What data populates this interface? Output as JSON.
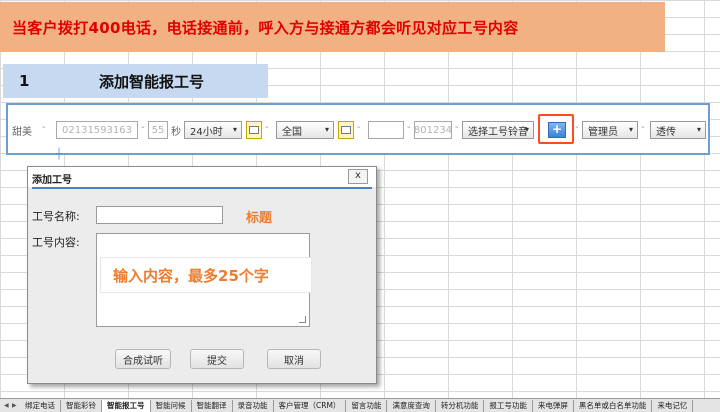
{
  "banner": {
    "text": "当客户拨打400电话，电话接通前，呼入方与接通方都会听见对应工号内容"
  },
  "section": {
    "number": "1",
    "title": "添加智能报工号"
  },
  "toolbar": {
    "label_tianmei": "甜美",
    "phone_value": "02131593163",
    "seconds_value": "55",
    "seconds_unit": "秒",
    "hours_select": "24小时",
    "region_select": "全国",
    "field_empty": "",
    "ext_value": "801234",
    "ringtone_select": "选择工号铃音",
    "add_icon": "+",
    "role_select": "管理员",
    "mode_select": "透传",
    "arrow": "▾"
  },
  "dialog": {
    "title": "添加工号",
    "close": "x",
    "name_label": "工号名称:",
    "content_label": "工号内容:",
    "name_value": "",
    "name_note": "标题",
    "content_note": "输入内容，最多25个字",
    "synth_button": "合成试听",
    "submit_button": "提交",
    "cancel_button": "取消"
  },
  "tabs": {
    "items": [
      "绑定电话",
      "智能彩铃",
      "智能报工号",
      "智能问候",
      "智能翻译",
      "录音功能",
      "客户管理（CRM）",
      "留言功能",
      "满意度查询",
      "转分机功能",
      "报工号功能",
      "来电弹屏",
      "黑名单或白名单功能",
      "来电记忆"
    ],
    "active_index": 2
  },
  "colors": {
    "banner_bg": "#f2b183",
    "banner_text": "#e00000",
    "section_bg": "#c6d9f1",
    "note": "#ed7d31",
    "highlight": "#ff4b1f"
  }
}
